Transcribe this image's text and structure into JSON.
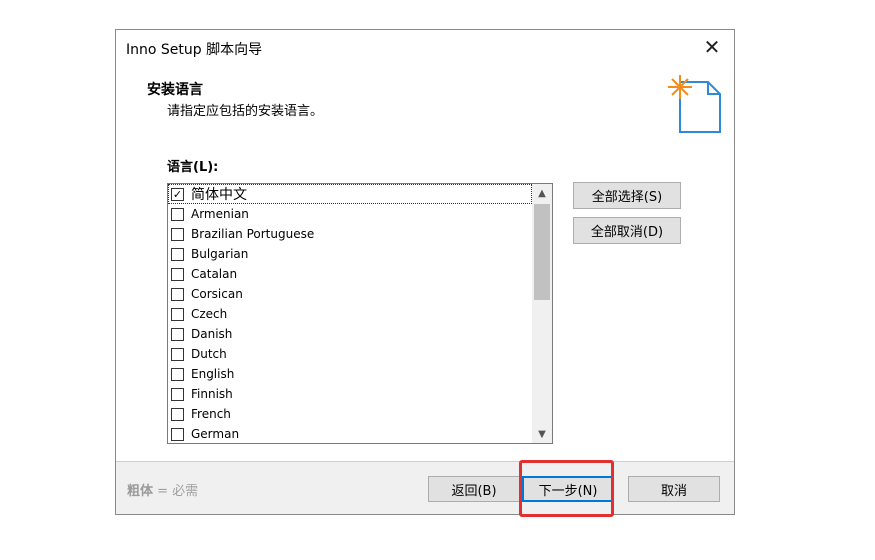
{
  "window": {
    "title": "Inno Setup 脚本向导"
  },
  "header": {
    "title": "安装语言",
    "subtitle": "请指定应包括的安装语言。"
  },
  "languages": {
    "label": "语言(L):",
    "items": [
      {
        "name": "简体中文",
        "checked": true
      },
      {
        "name": "Armenian",
        "checked": false
      },
      {
        "name": "Brazilian Portuguese",
        "checked": false
      },
      {
        "name": "Bulgarian",
        "checked": false
      },
      {
        "name": "Catalan",
        "checked": false
      },
      {
        "name": "Corsican",
        "checked": false
      },
      {
        "name": "Czech",
        "checked": false
      },
      {
        "name": "Danish",
        "checked": false
      },
      {
        "name": "Dutch",
        "checked": false
      },
      {
        "name": "English",
        "checked": false
      },
      {
        "name": "Finnish",
        "checked": false
      },
      {
        "name": "French",
        "checked": false
      },
      {
        "name": "German",
        "checked": false
      }
    ]
  },
  "buttons": {
    "select_all": "全部选择(S)",
    "deselect_all": "全部取消(D)",
    "back": "返回(B)",
    "next": "下一步(N)",
    "cancel": "取消"
  },
  "footer": {
    "bold_word": "粗体",
    "note": " = 必需"
  },
  "colors": {
    "highlight": "#e03030",
    "focus": "#0078d7",
    "icon_accent": "#f28c1b"
  }
}
